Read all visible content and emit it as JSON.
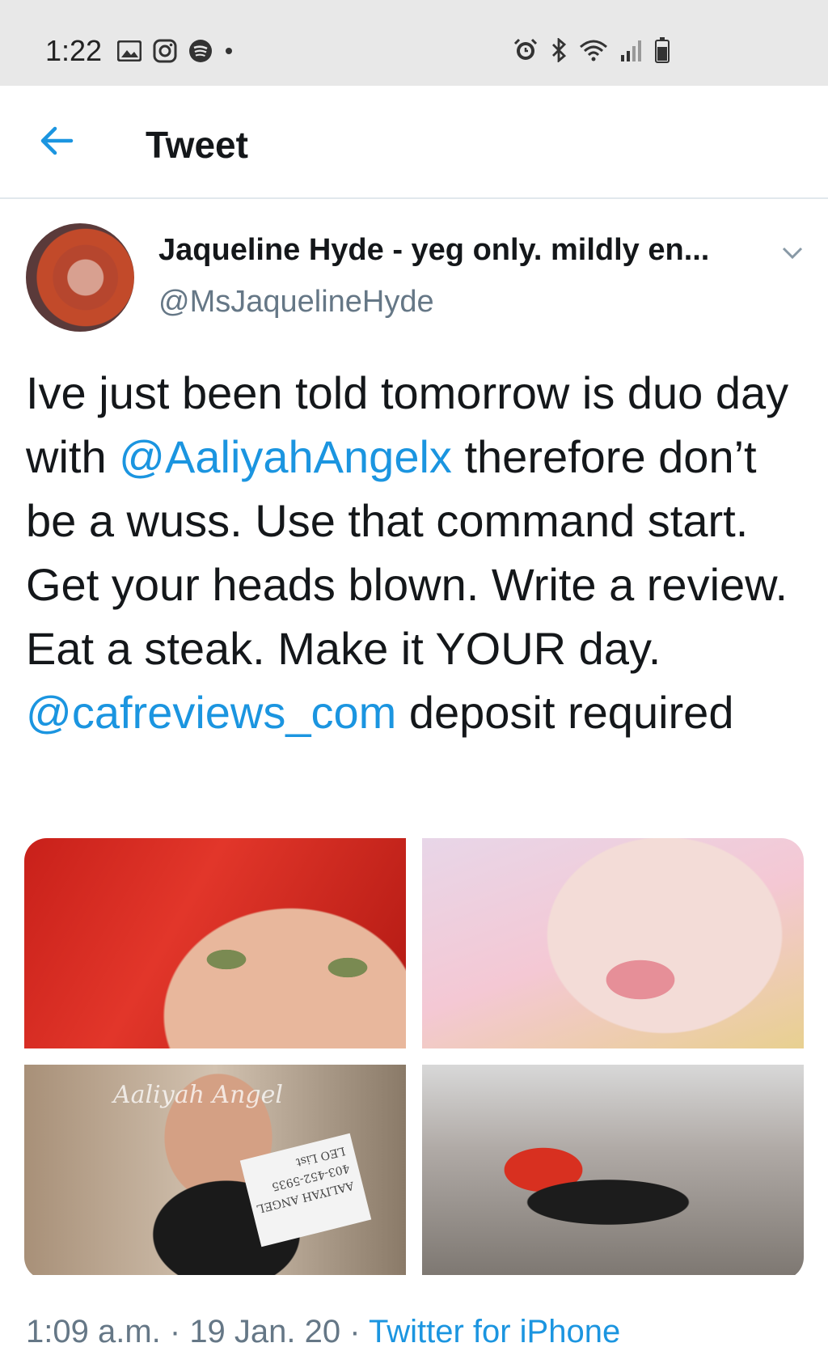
{
  "status_bar": {
    "time": "1:22",
    "left_icons": [
      "gallery-icon",
      "instagram-icon",
      "spotify-icon",
      "dot-icon"
    ],
    "right_icons": [
      "alarm-icon",
      "bluetooth-icon",
      "wifi-icon",
      "signal-icon",
      "battery-icon"
    ]
  },
  "header": {
    "title": "Tweet",
    "back_icon": "back-arrow-icon"
  },
  "tweet": {
    "author_name": "Jaqueline Hyde - yeg only. mildly en...",
    "author_handle": "@MsJaquelineHyde",
    "text_parts": [
      {
        "text": "Ive just been told tomorrow is duo day with ",
        "type": "text"
      },
      {
        "text": "@AaliyahAngelx",
        "type": "mention"
      },
      {
        "text": " therefore don’t be a wuss. Use that command start. Get your heads blown. Write a review. Eat a steak. Make it YOUR day. ",
        "type": "text"
      },
      {
        "text": "@cafreviews_com",
        "type": "mention"
      },
      {
        "text": "  deposit required",
        "type": "text"
      }
    ],
    "media_watermark": "Aaliyah Angel",
    "media_sign_lines": [
      "AALIYAH ANGEL",
      "403-452-5935",
      "LEO List"
    ],
    "time": "1:09 a.m.",
    "date": "19 Jan. 20",
    "source": "Twitter for iPhone",
    "separator": " · "
  },
  "colors": {
    "accent": "#1b95e0",
    "secondary_text": "#657786",
    "status_bar_bg": "#e8e8e8"
  }
}
